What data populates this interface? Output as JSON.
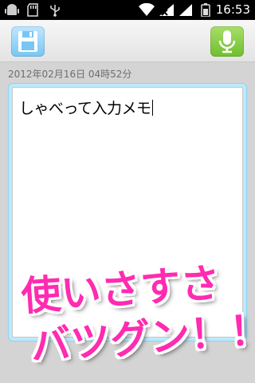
{
  "status_bar": {
    "time": "16:53",
    "icons": [
      "android-icon",
      "sd-card-icon",
      "usb-icon",
      "wifi-icon",
      "signal-icon",
      "no-sim-icon",
      "battery-icon"
    ]
  },
  "toolbar": {
    "save_icon": "floppy-save-icon",
    "mic_icon": "microphone-icon"
  },
  "memo": {
    "date": "2012年02月16日 04時52分",
    "text": "しゃべって入力メモ"
  },
  "promo": {
    "line1": "使いさすさ",
    "line2": "バツグン！！"
  },
  "colors": {
    "background": "#d4d4d4",
    "accent_blue": "#8fd2f0",
    "save_button": "#78c6f4",
    "mic_button": "#6fbf2e",
    "promo_pink": "#ff2bb0"
  }
}
